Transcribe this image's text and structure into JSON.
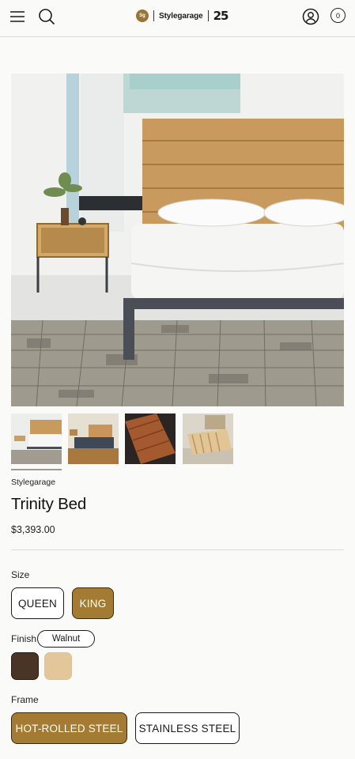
{
  "header": {
    "logo_badge": "Sg",
    "logo_name": "Stylegarage",
    "logo_anniversary": "25",
    "cart_count": "0"
  },
  "product": {
    "brand": "Stylegarage",
    "title": "Trinity Bed",
    "price": "$3,393.00"
  },
  "gallery": {
    "thumbnail_count": 4,
    "active_index": 0
  },
  "options": {
    "size": {
      "label": "Size",
      "choices": [
        "QUEEN",
        "KING"
      ],
      "selected": "KING"
    },
    "finish": {
      "label": "Finish",
      "selected_value": "Walnut",
      "swatches": [
        {
          "name": "walnut",
          "color": "#4a3426"
        },
        {
          "name": "oak",
          "color": "#e3c79b"
        }
      ]
    },
    "frame": {
      "label": "Frame",
      "choices": [
        "HOT-ROLLED STEEL",
        "STAINLESS STEEL"
      ],
      "selected": "HOT-ROLLED STEEL"
    }
  },
  "colors": {
    "accent": "#a47b33"
  }
}
